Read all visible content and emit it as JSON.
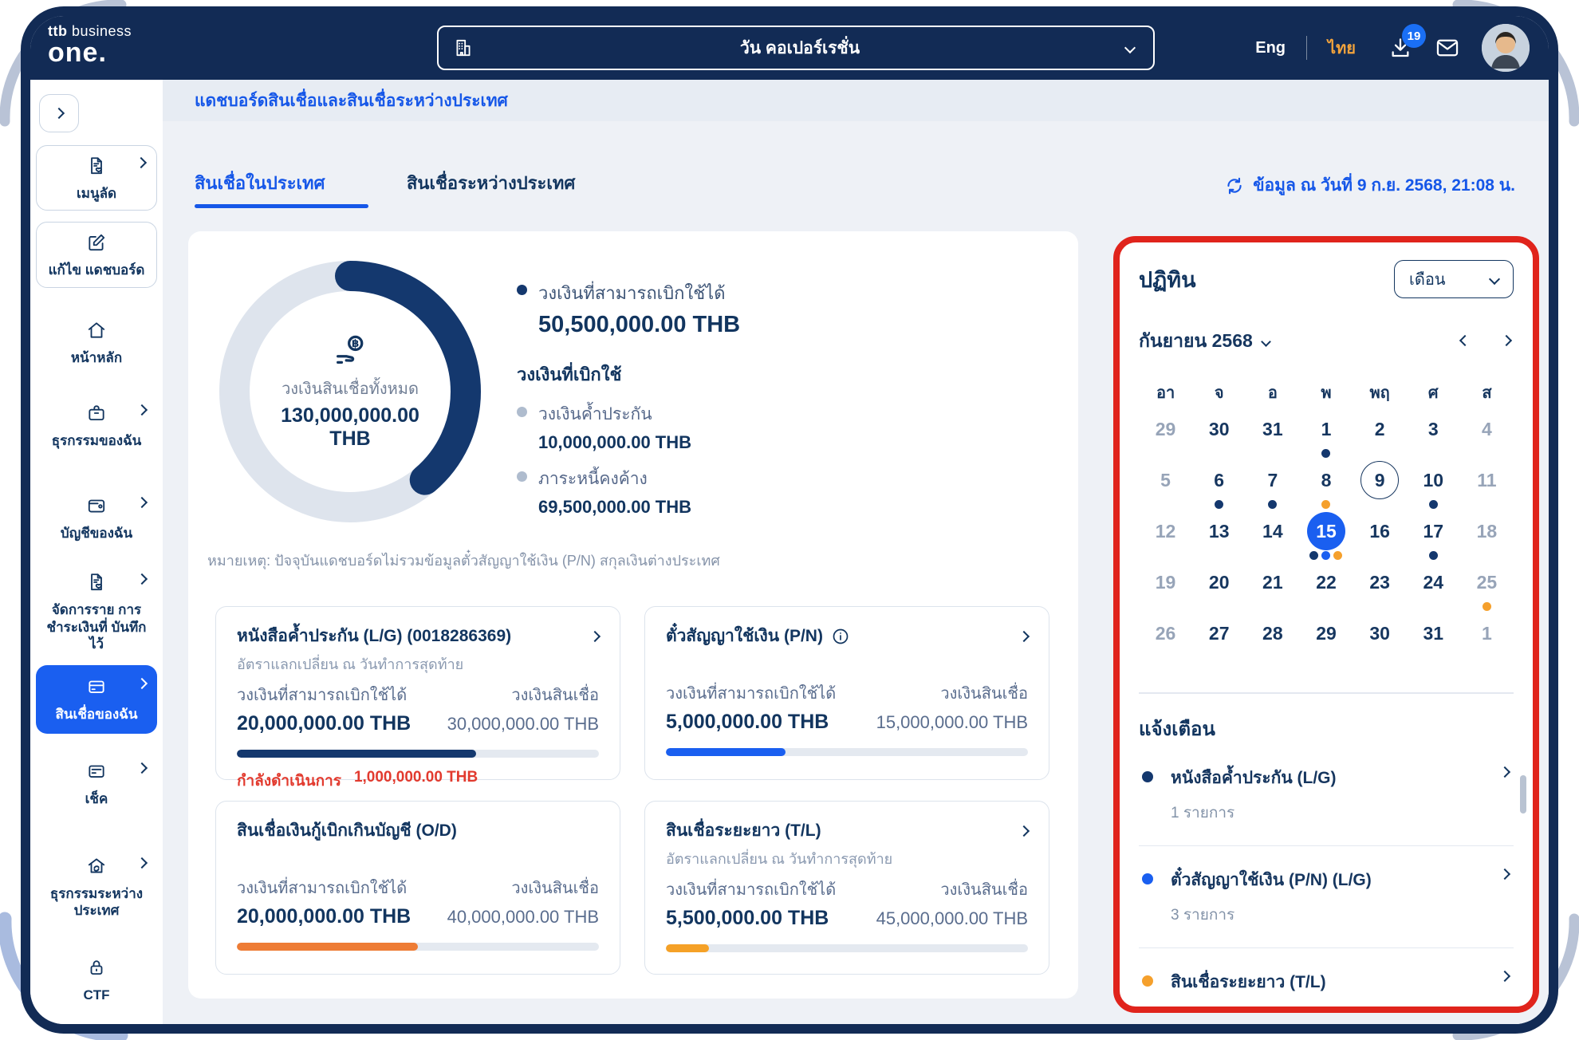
{
  "colors": {
    "navy": "#122B55",
    "accent_blue": "#1A5FF0",
    "link_blue": "#1657E8",
    "orange": "#F5A02C",
    "deep_orange": "#EE7C35",
    "red_annotation": "#E0241C",
    "red_status": "#E23A2E"
  },
  "brand": {
    "line1_bold": "ttb",
    "line1_rest": " business",
    "line2": "one."
  },
  "topbar": {
    "company_selector": "วัน คอเปอร์เรชั่น",
    "lang_en": "Eng",
    "lang_th": "ไทย",
    "download_badge": "19"
  },
  "sidebar": {
    "items": [
      {
        "label": "เมนูลัด"
      },
      {
        "label": "แก้ไข แดชบอร์ด"
      },
      {
        "label": "หน้าหลัก"
      },
      {
        "label": "ธุรกรรมของฉัน"
      },
      {
        "label": "บัญชีของฉัน"
      },
      {
        "label": "จัดการราย การชำระเงินที่ บันทึกไว้"
      },
      {
        "label": "สินเชื่อของฉัน",
        "active": true
      },
      {
        "label": "เช็ค"
      },
      {
        "label": "ธุรกรรมระหว่างประเทศ"
      },
      {
        "label": "CTF"
      }
    ]
  },
  "header": {
    "breadcrumb": "แดชบอร์ดสินเชื่อและสินเชื่อระหว่างประเทศ",
    "tab_domestic": "สินเชื่อในประเทศ",
    "tab_international": "สินเชื่อระหว่างประเทศ",
    "refresh": "ข้อมูล ณ วันที่ 9 ก.ย. 2568, 21:08 น."
  },
  "summary": {
    "center_label": "วงเงินสินเชื่อทั้งหมด",
    "center_value": "130,000,000.00 THB",
    "available_label": "วงเงินที่สามารถเบิกใช้ได้",
    "available_value": "50,500,000.00 THB",
    "used_heading": "วงเงินที่เบิกใช้",
    "guarantee_label": "วงเงินค้ำประกัน",
    "guarantee_value": "10,000,000.00 THB",
    "outstanding_label": "ภาระหนี้คงค้าง",
    "outstanding_value": "69,500,000.00 THB",
    "note": "หมายเหตุ: ปัจจุบันแดชบอร์ดไม่รวมข้อมูลตั๋วสัญญาใช้เงิน (P/N) สกุลเงินต่างประเทศ",
    "arc_percent": 38.8
  },
  "chart_data": {
    "type": "pie",
    "title": "วงเงินสินเชื่อทั้งหมด 130,000,000.00 THB",
    "labels": [
      "วงเงินที่สามารถเบิกใช้ได้",
      "วงเงินที่เบิกใช้"
    ],
    "values": [
      50500000,
      79500000
    ],
    "colors": [
      "#14386E",
      "#DEE4ED"
    ]
  },
  "products": [
    {
      "title": "หนังสือค้ำประกัน (L/G) (0018286369)",
      "subtitle": "อัตราแลกเปลี่ยน ณ วันทำการสุดท้าย",
      "avail_label": "วงเงินที่สามารถเบิกใช้ได้",
      "avail_value": "20,000,000.00 THB",
      "limit_label": "วงเงินสินเชื่อ",
      "limit_value": "30,000,000.00 THB",
      "progress": 66,
      "status_label": "กำลังดำเนินการ",
      "status_value": "1,000,000.00 THB"
    },
    {
      "title": "ตั๋วสัญญาใช้เงิน (P/N)",
      "subtitle": "",
      "avail_label": "วงเงินที่สามารถเบิกใช้ได้",
      "avail_value": "5,000,000.00 THB",
      "limit_label": "วงเงินสินเชื่อ",
      "limit_value": "15,000,000.00 THB",
      "progress": 33
    },
    {
      "title": "สินเชื่อเงินกู้เบิกเกินบัญชี (O/D)",
      "subtitle": "",
      "avail_label": "วงเงินที่สามารถเบิกใช้ได้",
      "avail_value": "20,000,000.00 THB",
      "limit_label": "วงเงินสินเชื่อ",
      "limit_value": "40,000,000.00 THB",
      "progress": 50
    },
    {
      "title": "สินเชื่อระยะยาว (T/L)",
      "subtitle": "อัตราแลกเปลี่ยน ณ วันทำการสุดท้าย",
      "avail_label": "วงเงินที่สามารถเบิกใช้ได้",
      "avail_value": "5,500,000.00 THB",
      "limit_label": "วงเงินสินเชื่อ",
      "limit_value": "45,000,000.00 THB",
      "progress": 12
    }
  ],
  "calendar": {
    "title": "ปฏิทิน",
    "view_selector": "เดือน",
    "month": "กันยายน 2568",
    "weekdays": [
      "อา",
      "จ",
      "อ",
      "พ",
      "พฤ",
      "ศ",
      "ส"
    ],
    "cells": [
      {
        "d": "29",
        "muted": true
      },
      {
        "d": "30"
      },
      {
        "d": "31"
      },
      {
        "d": "1",
        "dots": [
          "navy"
        ]
      },
      {
        "d": "2"
      },
      {
        "d": "3"
      },
      {
        "d": "4",
        "muted": true
      },
      {
        "d": "5",
        "muted": true
      },
      {
        "d": "6",
        "dots": [
          "navy"
        ]
      },
      {
        "d": "7",
        "dots": [
          "navy"
        ]
      },
      {
        "d": "8",
        "dots": [
          "orange"
        ]
      },
      {
        "d": "9",
        "today": true
      },
      {
        "d": "10",
        "dots": [
          "navy"
        ]
      },
      {
        "d": "11",
        "muted": true
      },
      {
        "d": "12",
        "muted": true
      },
      {
        "d": "13"
      },
      {
        "d": "14"
      },
      {
        "d": "15",
        "selected": true,
        "dots": [
          "navy",
          "blue",
          "orange"
        ]
      },
      {
        "d": "16"
      },
      {
        "d": "17",
        "dots": [
          "navy"
        ]
      },
      {
        "d": "18",
        "muted": true
      },
      {
        "d": "19",
        "muted": true
      },
      {
        "d": "20"
      },
      {
        "d": "21"
      },
      {
        "d": "22"
      },
      {
        "d": "23"
      },
      {
        "d": "24"
      },
      {
        "d": "25",
        "muted": true,
        "dots": [
          "orange"
        ]
      },
      {
        "d": "26",
        "muted": true
      },
      {
        "d": "27"
      },
      {
        "d": "28"
      },
      {
        "d": "29"
      },
      {
        "d": "30"
      },
      {
        "d": "31"
      },
      {
        "d": "1",
        "muted": true
      }
    ]
  },
  "notifications": {
    "title": "แจ้งเตือน",
    "items": [
      {
        "dot": "navy",
        "title": "หนังสือค้ำประกัน (L/G)",
        "count": "1 รายการ"
      },
      {
        "dot": "blue",
        "title": "ตั๋วสัญญาใช้เงิน (P/N) (L/G)",
        "count": "3 รายการ"
      },
      {
        "dot": "orange",
        "title": "สินเชื่อระยะยาว (T/L)",
        "count": ""
      }
    ]
  }
}
